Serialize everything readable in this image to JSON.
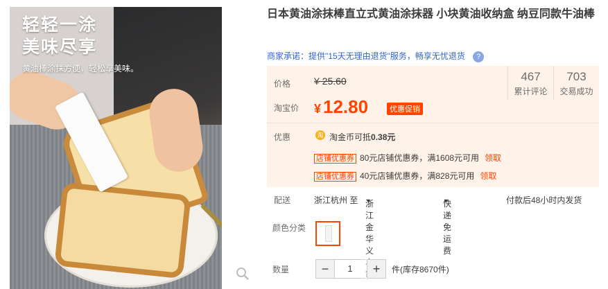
{
  "gallery": {
    "headline_1": "轻轻一涂",
    "headline_2": "美味尽享",
    "subline": "黄油棒涂抹方便，轻松享美味。"
  },
  "product": {
    "title": "日本黄油涂抹棒直立式黄油涂抹器 小块黄油收纳盒 纳豆同款牛油棒"
  },
  "promise": {
    "label": "商家承诺：",
    "text": "提供\"15天无理由退货\"服务，畅享无忧退货",
    "help": "?"
  },
  "price": {
    "price_label": "价格",
    "original": "¥ 25.60",
    "taobao_label": "淘宝价",
    "yen": "¥",
    "current": "12.80",
    "promo_tag": "优惠促销"
  },
  "stats": [
    {
      "value": "467",
      "label": "累计评论"
    },
    {
      "value": "703",
      "label": "交易成功"
    }
  ],
  "discount": {
    "label": "优惠",
    "coin_icon": "淘",
    "coin_text": "淘金币可抵",
    "coin_amount": "0.38元",
    "coupons": [
      {
        "tag": "店铺优惠券",
        "text": "80元店铺优惠券，满1608元可用",
        "action": "领取"
      },
      {
        "tag": "店铺优惠券",
        "text": "40元店铺优惠券，满828元可用",
        "action": "领取"
      }
    ]
  },
  "shipping": {
    "label": "配送",
    "from": "浙江杭州 至",
    "to": "浙江金华义乌市",
    "method": "快递 免运费",
    "note": "付款后48小时内发货"
  },
  "color": {
    "label": "颜色分类"
  },
  "quantity": {
    "label": "数量",
    "minus": "−",
    "value": "1",
    "plus": "+",
    "stock": "件(库存8670件)"
  },
  "colors": {
    "accent": "#ff4400",
    "panel_bg": "#fff2e8",
    "link": "#3366cc"
  }
}
